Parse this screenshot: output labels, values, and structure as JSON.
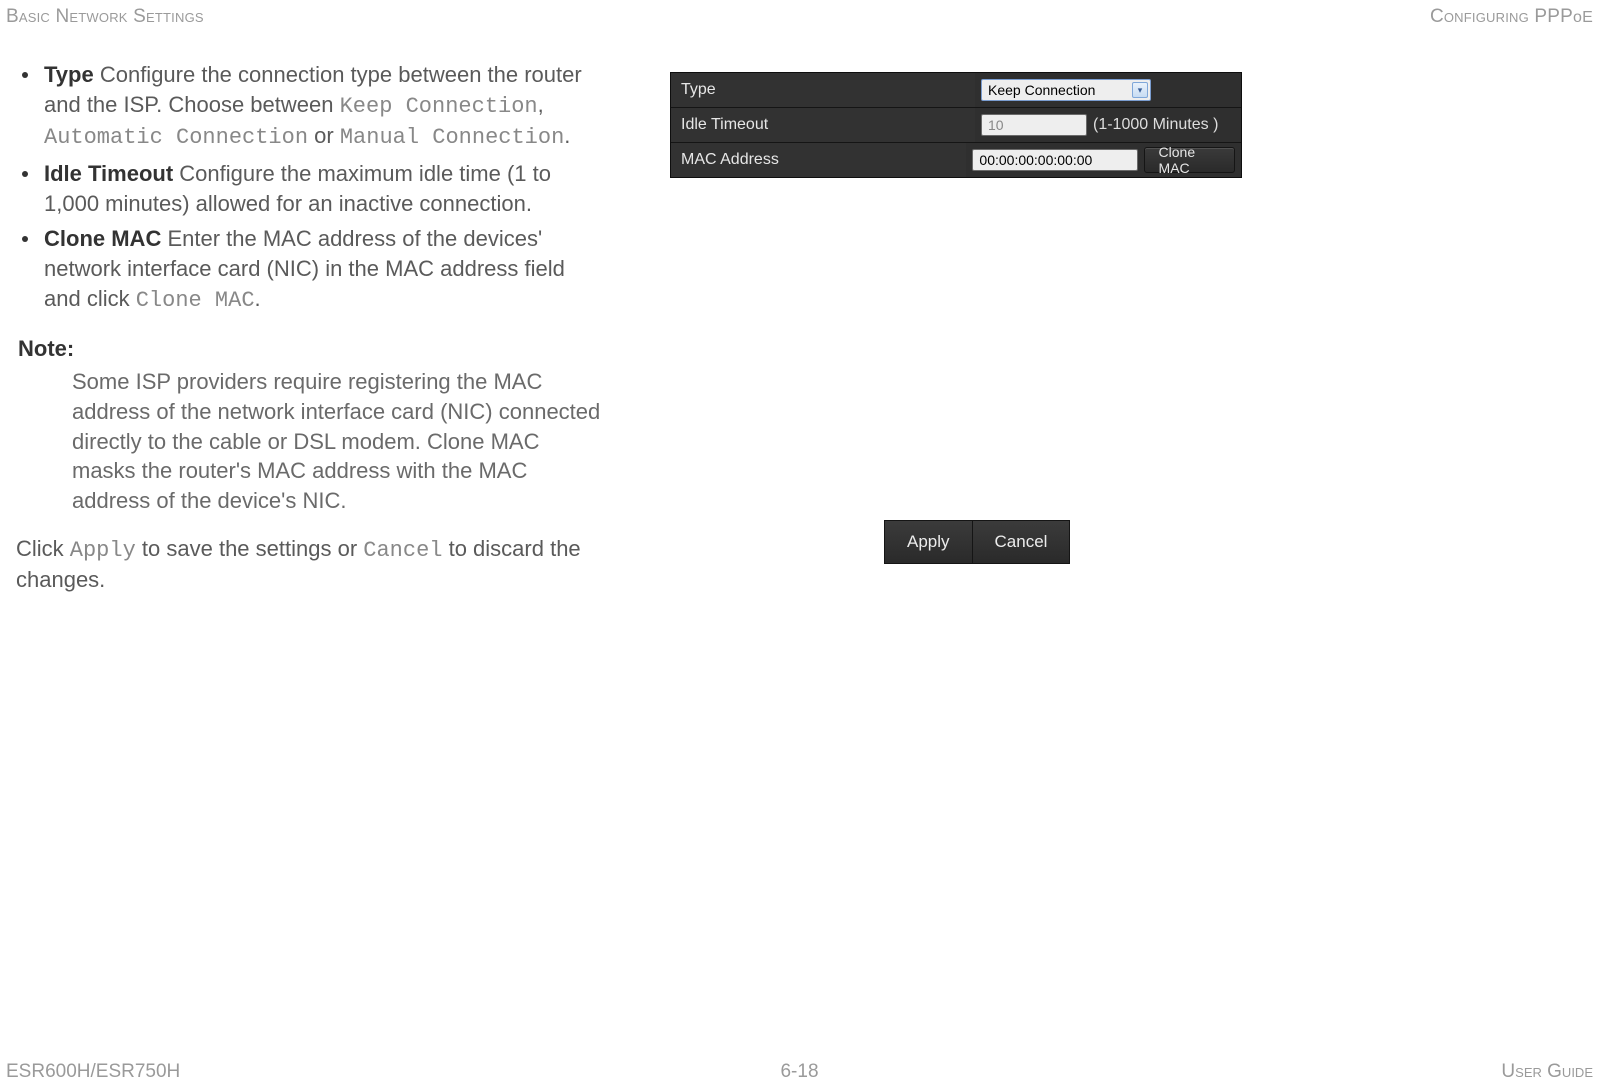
{
  "header": {
    "left": "Basic Network Settings",
    "right_prefix": "Configuring PPP",
    "right_suffix": "oE"
  },
  "footer": {
    "left": "ESR600H/ESR750H",
    "center": "6-18",
    "right": "User Guide"
  },
  "doc": {
    "bullets": {
      "type": {
        "term": "Type",
        "text1": "  Configure the connection type between the router and the ISP. Choose between ",
        "opt1": "Keep Connection",
        "sep1": ", ",
        "opt2": "Automatic Connection",
        "sep2": " or ",
        "opt3": "Manual Connection",
        "tail": "."
      },
      "idle": {
        "term": "Idle Timeout",
        "text": "  Configure the maximum idle time (1 to 1,000 minutes) allowed for an inactive connection."
      },
      "clone": {
        "term": "Clone MAC",
        "text1": "  Enter the MAC address of the devices' network interface card (NIC) in the MAC address field and click ",
        "mono": "Clone MAC",
        "tail": "."
      }
    },
    "note": {
      "label": "Note:",
      "body": "Some ISP providers require registering the MAC address of the network interface card (NIC) connected directly to the cable or DSL modem. Clone MAC masks the router's MAC address with the MAC address of the device's NIC."
    },
    "final": {
      "pre": "Click ",
      "apply": "Apply",
      "mid": " to save the settings or ",
      "cancel": "Cancel",
      "post": " to discard the changes."
    }
  },
  "panel": {
    "rows": {
      "type": {
        "label": "Type",
        "value": "Keep Connection"
      },
      "idle": {
        "label": "Idle Timeout",
        "value": "10",
        "hint": "(1-1000 Minutes )"
      },
      "mac": {
        "label": "MAC Address",
        "value": "00:00:00:00:00:00",
        "button": "Clone MAC"
      }
    }
  },
  "buttons": {
    "apply": "Apply",
    "cancel": "Cancel"
  }
}
